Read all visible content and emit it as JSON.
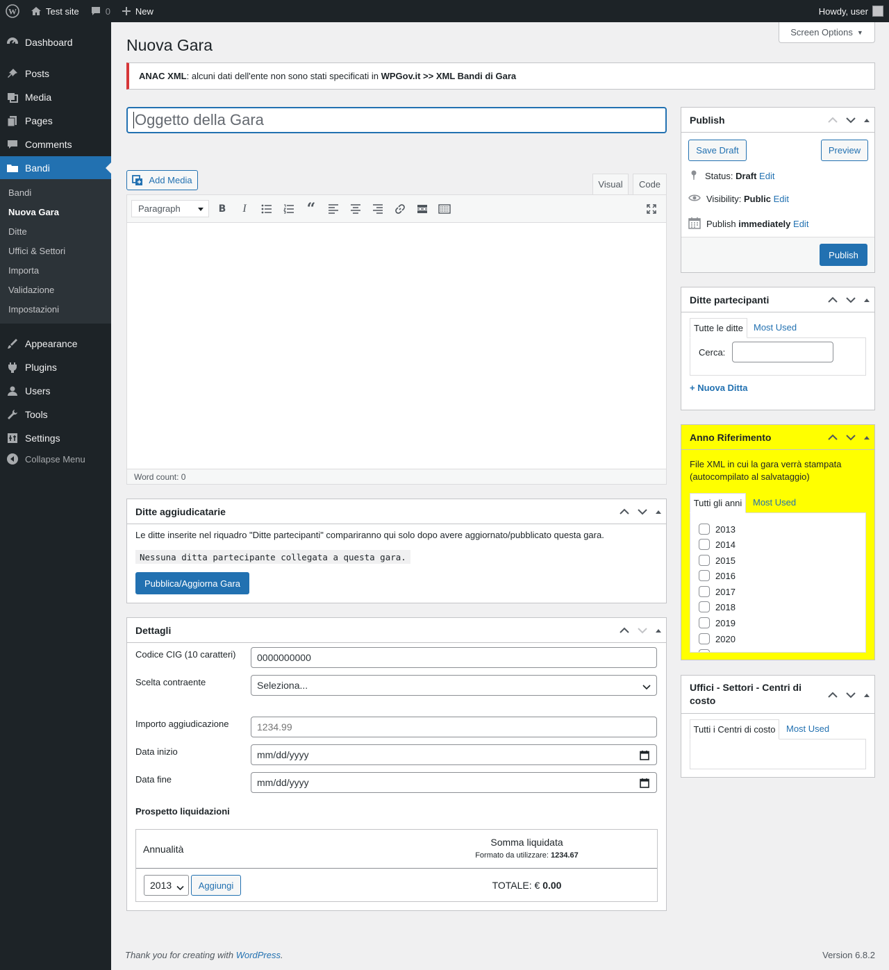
{
  "adminbar": {
    "site": "Test site",
    "comments": "0",
    "new": "New",
    "howdy": "Howdy, user"
  },
  "menu": {
    "dashboard": "Dashboard",
    "posts": "Posts",
    "media": "Media",
    "pages": "Pages",
    "comments": "Comments",
    "bandi": "Bandi",
    "appearance": "Appearance",
    "plugins": "Plugins",
    "users": "Users",
    "tools": "Tools",
    "settings": "Settings",
    "collapse": "Collapse Menu",
    "sub": [
      "Bandi",
      "Nuova Gara",
      "Ditte",
      "Uffici & Settori",
      "Importa",
      "Validazione",
      "Impostazioni"
    ]
  },
  "page": {
    "title": "Nuova Gara",
    "screen_options": "Screen Options"
  },
  "notice": {
    "strong1": "ANAC XML",
    "text": ": alcuni dati dell'ente non sono stati specificati in ",
    "strong2": "WPGov.it >> XML Bandi di Gara"
  },
  "post_title": {
    "placeholder": "Oggetto della Gara"
  },
  "editor": {
    "add_media": "Add Media",
    "tab_visual": "Visual",
    "tab_code": "Code",
    "format": "Paragraph",
    "word_count": "Word count: 0"
  },
  "publish": {
    "title": "Publish",
    "save_draft": "Save Draft",
    "preview": "Preview",
    "status_label": "Status: ",
    "status_value": "Draft",
    "visibility_label": "Visibility: ",
    "visibility_value": "Public",
    "publish_label": "Publish ",
    "publish_value": "immediately",
    "edit": "Edit",
    "publish_btn": "Publish"
  },
  "ditte_part": {
    "title": "Ditte partecipanti",
    "tab_all": "Tutte le ditte",
    "tab_most": "Most Used",
    "search_label": "Cerca:",
    "add_link": "+ Nuova Ditta"
  },
  "anno": {
    "title": "Anno Riferimento",
    "desc": "File XML in cui la gara verrà stampata (autocompilato al salvataggio)",
    "tab_all": "Tutti gli anni",
    "tab_most": "Most Used",
    "years": [
      "2013",
      "2014",
      "2015",
      "2016",
      "2017",
      "2018",
      "2019",
      "2020"
    ]
  },
  "uffici": {
    "title_line1": "Uffici - Settori - Centri di",
    "title_line2": "costo",
    "tab_all": "Tutti i Centri di costo",
    "tab_most": "Most Used"
  },
  "aggiud": {
    "title": "Ditte aggiudicatarie",
    "desc": "Le ditte inserite nel riquadro \"Ditte partecipanti\" compariranno qui solo dopo avere aggiornato/pubblicato questa gara.",
    "code": "Nessuna ditta partecipante collegata a questa gara.",
    "button": "Pubblica/Aggiorna Gara"
  },
  "dettagli": {
    "title": "Dettagli",
    "cig_label": "Codice CIG (10 caratteri)",
    "cig_value": "0000000000",
    "scelta_label": "Scelta contraente",
    "scelta_value": "Seleziona...",
    "importo_label": "Importo aggiudicazione",
    "importo_placeholder": "1234.99",
    "inizio_label": "Data inizio",
    "inizio_value": "mm/dd/yyyy",
    "fine_label": "Data fine",
    "fine_value": "mm/dd/yyyy",
    "prospetto": "Prospetto liquidazioni",
    "col_annualita": "Annualità",
    "col_somma": "Somma liquidata",
    "formato_label": "Formato da utilizzare: ",
    "formato_value": "1234.67",
    "year_select": "2013",
    "aggiungi": "Aggiungi",
    "totale_label": "TOTALE: € ",
    "totale_value": "0.00"
  },
  "footer": {
    "thanks_pre": "Thank you for creating with ",
    "thanks_link": "WordPress",
    "thanks_post": ".",
    "version": "Version 6.8.2"
  }
}
